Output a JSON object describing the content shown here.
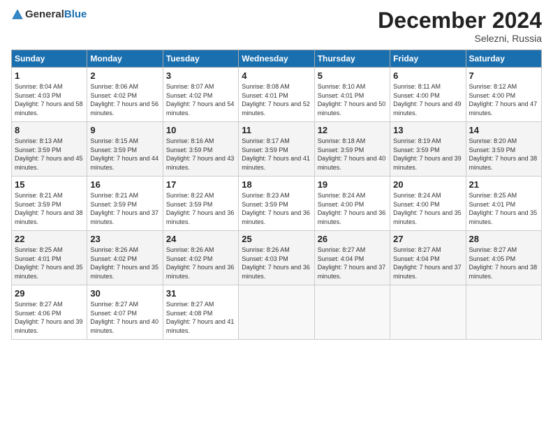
{
  "logo": {
    "text_general": "General",
    "text_blue": "Blue"
  },
  "title": "December 2024",
  "location": "Selezni, Russia",
  "days_of_week": [
    "Sunday",
    "Monday",
    "Tuesday",
    "Wednesday",
    "Thursday",
    "Friday",
    "Saturday"
  ],
  "weeks": [
    [
      {
        "day": 1,
        "sunrise": "8:04 AM",
        "sunset": "4:03 PM",
        "daylight": "7 hours and 58 minutes."
      },
      {
        "day": 2,
        "sunrise": "8:06 AM",
        "sunset": "4:02 PM",
        "daylight": "7 hours and 56 minutes."
      },
      {
        "day": 3,
        "sunrise": "8:07 AM",
        "sunset": "4:02 PM",
        "daylight": "7 hours and 54 minutes."
      },
      {
        "day": 4,
        "sunrise": "8:08 AM",
        "sunset": "4:01 PM",
        "daylight": "7 hours and 52 minutes."
      },
      {
        "day": 5,
        "sunrise": "8:10 AM",
        "sunset": "4:01 PM",
        "daylight": "7 hours and 50 minutes."
      },
      {
        "day": 6,
        "sunrise": "8:11 AM",
        "sunset": "4:00 PM",
        "daylight": "7 hours and 49 minutes."
      },
      {
        "day": 7,
        "sunrise": "8:12 AM",
        "sunset": "4:00 PM",
        "daylight": "7 hours and 47 minutes."
      }
    ],
    [
      {
        "day": 8,
        "sunrise": "8:13 AM",
        "sunset": "3:59 PM",
        "daylight": "7 hours and 45 minutes."
      },
      {
        "day": 9,
        "sunrise": "8:15 AM",
        "sunset": "3:59 PM",
        "daylight": "7 hours and 44 minutes."
      },
      {
        "day": 10,
        "sunrise": "8:16 AM",
        "sunset": "3:59 PM",
        "daylight": "7 hours and 43 minutes."
      },
      {
        "day": 11,
        "sunrise": "8:17 AM",
        "sunset": "3:59 PM",
        "daylight": "7 hours and 41 minutes."
      },
      {
        "day": 12,
        "sunrise": "8:18 AM",
        "sunset": "3:59 PM",
        "daylight": "7 hours and 40 minutes."
      },
      {
        "day": 13,
        "sunrise": "8:19 AM",
        "sunset": "3:59 PM",
        "daylight": "7 hours and 39 minutes."
      },
      {
        "day": 14,
        "sunrise": "8:20 AM",
        "sunset": "3:59 PM",
        "daylight": "7 hours and 38 minutes."
      }
    ],
    [
      {
        "day": 15,
        "sunrise": "8:21 AM",
        "sunset": "3:59 PM",
        "daylight": "7 hours and 38 minutes."
      },
      {
        "day": 16,
        "sunrise": "8:21 AM",
        "sunset": "3:59 PM",
        "daylight": "7 hours and 37 minutes."
      },
      {
        "day": 17,
        "sunrise": "8:22 AM",
        "sunset": "3:59 PM",
        "daylight": "7 hours and 36 minutes."
      },
      {
        "day": 18,
        "sunrise": "8:23 AM",
        "sunset": "3:59 PM",
        "daylight": "7 hours and 36 minutes."
      },
      {
        "day": 19,
        "sunrise": "8:24 AM",
        "sunset": "4:00 PM",
        "daylight": "7 hours and 36 minutes."
      },
      {
        "day": 20,
        "sunrise": "8:24 AM",
        "sunset": "4:00 PM",
        "daylight": "7 hours and 35 minutes."
      },
      {
        "day": 21,
        "sunrise": "8:25 AM",
        "sunset": "4:01 PM",
        "daylight": "7 hours and 35 minutes."
      }
    ],
    [
      {
        "day": 22,
        "sunrise": "8:25 AM",
        "sunset": "4:01 PM",
        "daylight": "7 hours and 35 minutes."
      },
      {
        "day": 23,
        "sunrise": "8:26 AM",
        "sunset": "4:02 PM",
        "daylight": "7 hours and 35 minutes."
      },
      {
        "day": 24,
        "sunrise": "8:26 AM",
        "sunset": "4:02 PM",
        "daylight": "7 hours and 36 minutes."
      },
      {
        "day": 25,
        "sunrise": "8:26 AM",
        "sunset": "4:03 PM",
        "daylight": "7 hours and 36 minutes."
      },
      {
        "day": 26,
        "sunrise": "8:27 AM",
        "sunset": "4:04 PM",
        "daylight": "7 hours and 37 minutes."
      },
      {
        "day": 27,
        "sunrise": "8:27 AM",
        "sunset": "4:04 PM",
        "daylight": "7 hours and 37 minutes."
      },
      {
        "day": 28,
        "sunrise": "8:27 AM",
        "sunset": "4:05 PM",
        "daylight": "7 hours and 38 minutes."
      }
    ],
    [
      {
        "day": 29,
        "sunrise": "8:27 AM",
        "sunset": "4:06 PM",
        "daylight": "7 hours and 39 minutes."
      },
      {
        "day": 30,
        "sunrise": "8:27 AM",
        "sunset": "4:07 PM",
        "daylight": "7 hours and 40 minutes."
      },
      {
        "day": 31,
        "sunrise": "8:27 AM",
        "sunset": "4:08 PM",
        "daylight": "7 hours and 41 minutes."
      },
      null,
      null,
      null,
      null
    ]
  ]
}
